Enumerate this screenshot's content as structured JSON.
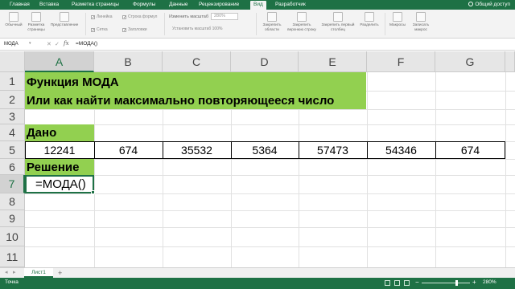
{
  "ribbon_tabs": [
    "Главная",
    "Вставка",
    "Разметка страницы",
    "Формулы",
    "Данные",
    "Рецензирование",
    "Вид",
    "Разработчик"
  ],
  "active_tab": "Вид",
  "share_label": "Общий доступ",
  "ribbon": {
    "normal": "Обычный",
    "page_layout": "Разметка страницы",
    "page_view": "Представление",
    "ruler": "Линейка",
    "formula_bar": "Строка формул",
    "gridlines": "Сетка",
    "headings": "Заголовки",
    "zoom_label": "Изменить масштаб",
    "zoom_value": "280%",
    "zoom_fit": "Установить масштаб 100%",
    "freeze_panes": "Закрепить области",
    "freeze_top": "Закрепить верхнюю строку",
    "freeze_first_col": "Закрепить первый столбец",
    "split": "Разделить",
    "macros": "Макросы",
    "record_macro": "Записать макрос"
  },
  "formula_bar": {
    "name_box": "МОДА",
    "fx": "fx",
    "formula": "=МОДА()"
  },
  "columns": [
    "A",
    "B",
    "C",
    "D",
    "E",
    "F",
    "G"
  ],
  "rows": [
    "1",
    "2",
    "3",
    "4",
    "5",
    "6",
    "7",
    "8",
    "9",
    "10",
    "11"
  ],
  "cells": {
    "a1": "Функция МОДА",
    "a2": "Или как найти максимально повторяющееся число",
    "a4": "Дано",
    "row5": [
      "12241",
      "674",
      "35532",
      "5364",
      "57473",
      "54346",
      "674"
    ],
    "a6": "Решение",
    "a7": "=МОДА()"
  },
  "sheet_tab": "Лист1",
  "add_sheet": "+",
  "status": "Точка",
  "zoom_percent": "280%",
  "colors": {
    "excel_green": "#1e7145",
    "highlight": "#92d050"
  }
}
